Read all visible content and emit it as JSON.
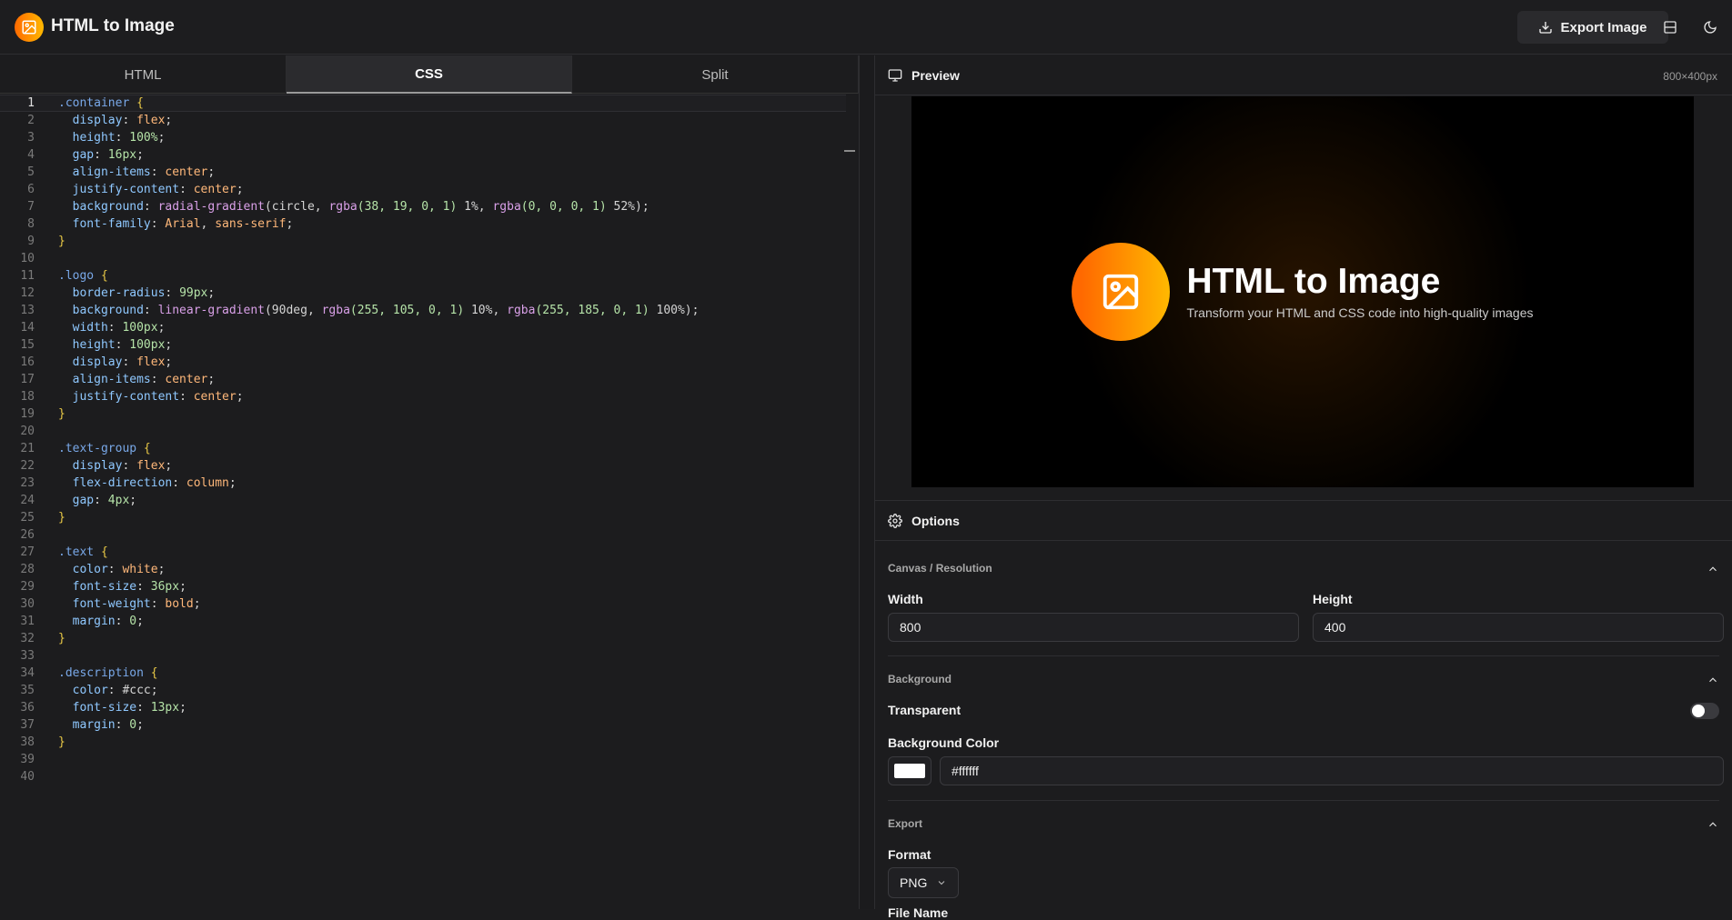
{
  "app": {
    "title": "HTML to Image",
    "export_label": "Export Image"
  },
  "editor": {
    "tabs": [
      "HTML",
      "CSS",
      "Split"
    ],
    "active_tab": "CSS",
    "lines": [
      [
        [
          ".container",
          "sel"
        ],
        [
          " {",
          "brace"
        ]
      ],
      [
        [
          "  display",
          "prop"
        ],
        [
          ": ",
          "punct"
        ],
        [
          "flex",
          "val"
        ],
        [
          ";",
          "punct"
        ]
      ],
      [
        [
          "  height",
          "prop"
        ],
        [
          ": ",
          "punct"
        ],
        [
          "100%",
          "num"
        ],
        [
          ";",
          "punct"
        ]
      ],
      [
        [
          "  gap",
          "prop"
        ],
        [
          ": ",
          "punct"
        ],
        [
          "16px",
          "num"
        ],
        [
          ";",
          "punct"
        ]
      ],
      [
        [
          "  align-items",
          "prop"
        ],
        [
          ": ",
          "punct"
        ],
        [
          "center",
          "val"
        ],
        [
          ";",
          "punct"
        ]
      ],
      [
        [
          "  justify-content",
          "prop"
        ],
        [
          ": ",
          "punct"
        ],
        [
          "center",
          "val"
        ],
        [
          ";",
          "punct"
        ]
      ],
      [
        [
          "  background",
          "prop"
        ],
        [
          ": ",
          "punct"
        ],
        [
          "radial-gradient",
          "fn"
        ],
        [
          "(circle, ",
          "punct"
        ],
        [
          "rgba",
          "fn"
        ],
        [
          "(38, 19, 0, 1)",
          "num"
        ],
        [
          " 1%, ",
          "punct"
        ],
        [
          "rgba",
          "fn"
        ],
        [
          "(0, 0, 0, 1)",
          "num"
        ],
        [
          " 52%);",
          "punct"
        ]
      ],
      [
        [
          "  font-family",
          "prop"
        ],
        [
          ": ",
          "punct"
        ],
        [
          "Arial",
          "val"
        ],
        [
          ", ",
          "punct"
        ],
        [
          "sans-serif",
          "val"
        ],
        [
          ";",
          "punct"
        ]
      ],
      [
        [
          "}",
          "brace"
        ]
      ],
      [],
      [
        [
          ".logo",
          "sel"
        ],
        [
          " {",
          "brace"
        ]
      ],
      [
        [
          "  border-radius",
          "prop"
        ],
        [
          ": ",
          "punct"
        ],
        [
          "99px",
          "num"
        ],
        [
          ";",
          "punct"
        ]
      ],
      [
        [
          "  background",
          "prop"
        ],
        [
          ": ",
          "punct"
        ],
        [
          "linear-gradient",
          "fn"
        ],
        [
          "(90deg, ",
          "punct"
        ],
        [
          "rgba",
          "fn"
        ],
        [
          "(255, 105, 0, 1)",
          "num"
        ],
        [
          " 10%, ",
          "punct"
        ],
        [
          "rgba",
          "fn"
        ],
        [
          "(255, 185, 0, 1)",
          "num"
        ],
        [
          " 100%);",
          "punct"
        ]
      ],
      [
        [
          "  width",
          "prop"
        ],
        [
          ": ",
          "punct"
        ],
        [
          "100px",
          "num"
        ],
        [
          ";",
          "punct"
        ]
      ],
      [
        [
          "  height",
          "prop"
        ],
        [
          ": ",
          "punct"
        ],
        [
          "100px",
          "num"
        ],
        [
          ";",
          "punct"
        ]
      ],
      [
        [
          "  display",
          "prop"
        ],
        [
          ": ",
          "punct"
        ],
        [
          "flex",
          "val"
        ],
        [
          ";",
          "punct"
        ]
      ],
      [
        [
          "  align-items",
          "prop"
        ],
        [
          ": ",
          "punct"
        ],
        [
          "center",
          "val"
        ],
        [
          ";",
          "punct"
        ]
      ],
      [
        [
          "  justify-content",
          "prop"
        ],
        [
          ": ",
          "punct"
        ],
        [
          "center",
          "val"
        ],
        [
          ";",
          "punct"
        ]
      ],
      [
        [
          "}",
          "brace"
        ]
      ],
      [],
      [
        [
          ".text-group",
          "sel"
        ],
        [
          " {",
          "brace"
        ]
      ],
      [
        [
          "  display",
          "prop"
        ],
        [
          ": ",
          "punct"
        ],
        [
          "flex",
          "val"
        ],
        [
          ";",
          "punct"
        ]
      ],
      [
        [
          "  flex-direction",
          "prop"
        ],
        [
          ": ",
          "punct"
        ],
        [
          "column",
          "val"
        ],
        [
          ";",
          "punct"
        ]
      ],
      [
        [
          "  gap",
          "prop"
        ],
        [
          ": ",
          "punct"
        ],
        [
          "4px",
          "num"
        ],
        [
          ";",
          "punct"
        ]
      ],
      [
        [
          "}",
          "brace"
        ]
      ],
      [],
      [
        [
          ".text",
          "sel"
        ],
        [
          " {",
          "brace"
        ]
      ],
      [
        [
          "  color",
          "prop"
        ],
        [
          ": ",
          "punct"
        ],
        [
          "white",
          "val"
        ],
        [
          ";",
          "punct"
        ]
      ],
      [
        [
          "  font-size",
          "prop"
        ],
        [
          ": ",
          "punct"
        ],
        [
          "36px",
          "num"
        ],
        [
          ";",
          "punct"
        ]
      ],
      [
        [
          "  font-weight",
          "prop"
        ],
        [
          ": ",
          "punct"
        ],
        [
          "bold",
          "val"
        ],
        [
          ";",
          "punct"
        ]
      ],
      [
        [
          "  margin",
          "prop"
        ],
        [
          ": ",
          "punct"
        ],
        [
          "0",
          "num"
        ],
        [
          ";",
          "punct"
        ]
      ],
      [
        [
          "}",
          "brace"
        ]
      ],
      [],
      [
        [
          ".description",
          "sel"
        ],
        [
          " {",
          "brace"
        ]
      ],
      [
        [
          "  color",
          "prop"
        ],
        [
          ": ",
          "punct"
        ],
        [
          "#ccc",
          "punct"
        ],
        [
          ";",
          "punct"
        ]
      ],
      [
        [
          "  font-size",
          "prop"
        ],
        [
          ": ",
          "punct"
        ],
        [
          "13px",
          "num"
        ],
        [
          ";",
          "punct"
        ]
      ],
      [
        [
          "  margin",
          "prop"
        ],
        [
          ": ",
          "punct"
        ],
        [
          "0",
          "num"
        ],
        [
          ";",
          "punct"
        ]
      ],
      [
        [
          "}",
          "brace"
        ]
      ],
      [],
      []
    ]
  },
  "preview": {
    "title": "Preview",
    "size_label": "800×400px",
    "heading": "HTML to Image",
    "description": "Transform your HTML and CSS code into high-quality images"
  },
  "options": {
    "title": "Options",
    "canvas_section": "Canvas / Resolution",
    "width_label": "Width",
    "width_value": "800",
    "height_label": "Height",
    "height_value": "400",
    "background_section": "Background",
    "transparent_label": "Transparent",
    "transparent_on": false,
    "bg_color_label": "Background Color",
    "bg_color_value": "#ffffff",
    "export_section": "Export",
    "format_label": "Format",
    "format_value": "PNG",
    "file_name_label": "File Name"
  },
  "colors": {
    "accent_start": "#ff6900",
    "accent_end": "#ffb900"
  },
  "icons": [
    "image-icon",
    "download-icon",
    "layout-icon",
    "moon-icon",
    "monitor-icon",
    "gear-icon",
    "chevron-up-icon",
    "chevron-down-icon"
  ]
}
